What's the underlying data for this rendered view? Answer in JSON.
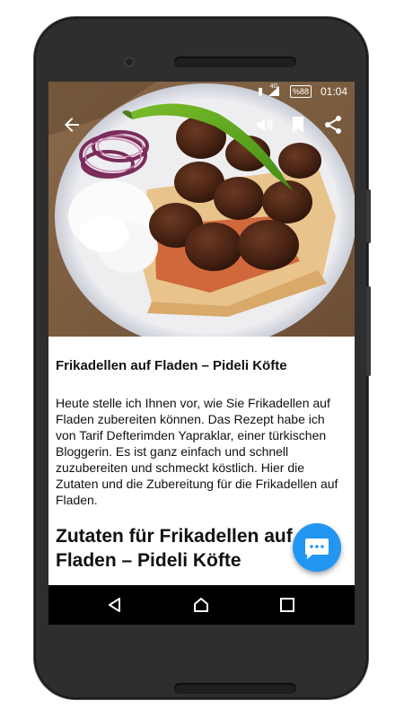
{
  "status_bar": {
    "battery": "%88",
    "network": "4G",
    "time": "01:04"
  },
  "app_bar": {
    "back_icon": "back-arrow-icon",
    "listen_icon": "speaker-icon",
    "bookmark_icon": "bookmark-icon",
    "share_icon": "share-icon"
  },
  "article": {
    "title": "Frikadellen auf Fladen – Pideli Köfte",
    "intro": "Heute stelle ich Ihnen vor, wie Sie Frikadellen auf Fladen zubereiten können. Das Rezept habe ich von Tarif Defterimden Yapraklar, einer türkischen Bloggerin. Es ist ganz einfach und schnell zuzubereiten und schmeckt köstlich. Hier die Zutaten und die Zubereitung für die Frikadellen auf Fladen.",
    "section_heading": "Zutaten für Frikadellen auf Fladen – Pideli Köfte"
  },
  "fab": {
    "icon": "chat-bubble-icon"
  },
  "nav_bar": {
    "back_icon": "nav-back-icon",
    "home_icon": "nav-home-icon",
    "recents_icon": "nav-recents-icon"
  },
  "colors": {
    "accent": "#2196f3",
    "nav_background": "#000000",
    "device_frame": "#2e2e2e"
  }
}
